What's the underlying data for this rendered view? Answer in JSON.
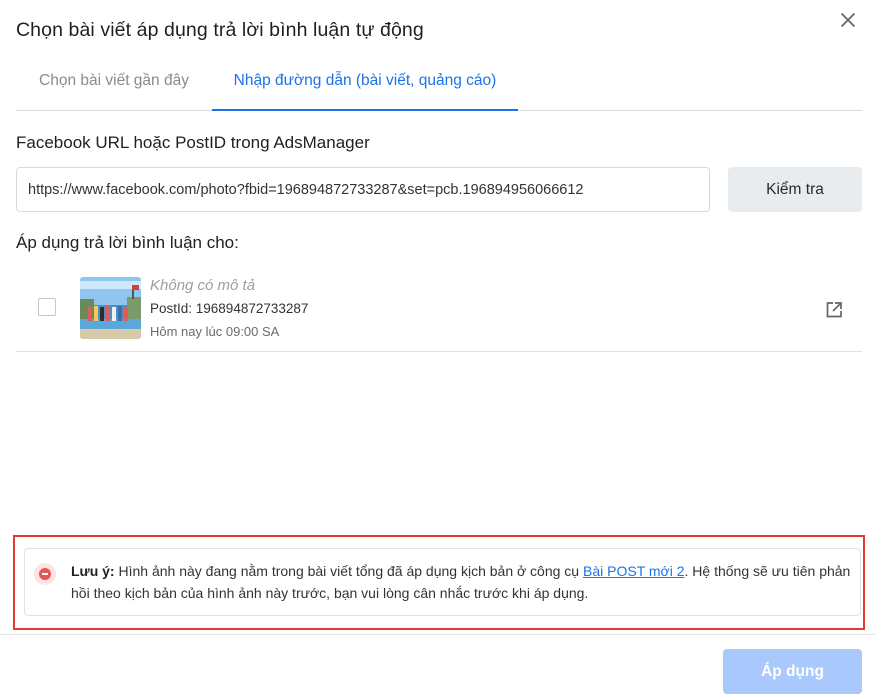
{
  "dialog": {
    "title": "Chọn bài viết áp dụng trả lời bình luận tự động"
  },
  "tabs": [
    {
      "label": "Chọn bài viết gần đây",
      "active": false
    },
    {
      "label": "Nhập đường dẫn (bài viết, quảng cáo)",
      "active": true
    }
  ],
  "url_section": {
    "label": "Facebook URL hoặc PostID trong AdsManager",
    "value": "https://www.facebook.com/photo?fbid=196894872733287&set=pcb.196894956066612",
    "check_button": "Kiểm tra"
  },
  "apply_section": {
    "label": "Áp dụng trả lời bình luận cho:"
  },
  "post": {
    "description": "Không có mô tả",
    "post_id": "PostId: 196894872733287",
    "time": "Hôm nay lúc 09:00 SA",
    "checked": false
  },
  "note": {
    "prefix": "Lưu ý:",
    "text_before": " Hình ảnh này đang nằm trong bài viết tổng đã áp dụng kịch bản ở công cụ ",
    "link": "Bài POST mới 2",
    "text_after": ". Hệ thống sẽ ưu tiên phản hồi theo kịch bản của hình ảnh này trước, bạn vui lòng cân nhắc trước khi áp dụng."
  },
  "footer": {
    "apply_button": "Áp dụng"
  },
  "colors": {
    "accent": "#1a73e8",
    "apply_disabled": "#a9c8fb",
    "warning": "#e45757",
    "highlight_border": "#e53935"
  },
  "icons": {
    "close": "close-icon",
    "open_external": "open-external-icon",
    "warning": "minus-circle-icon"
  }
}
